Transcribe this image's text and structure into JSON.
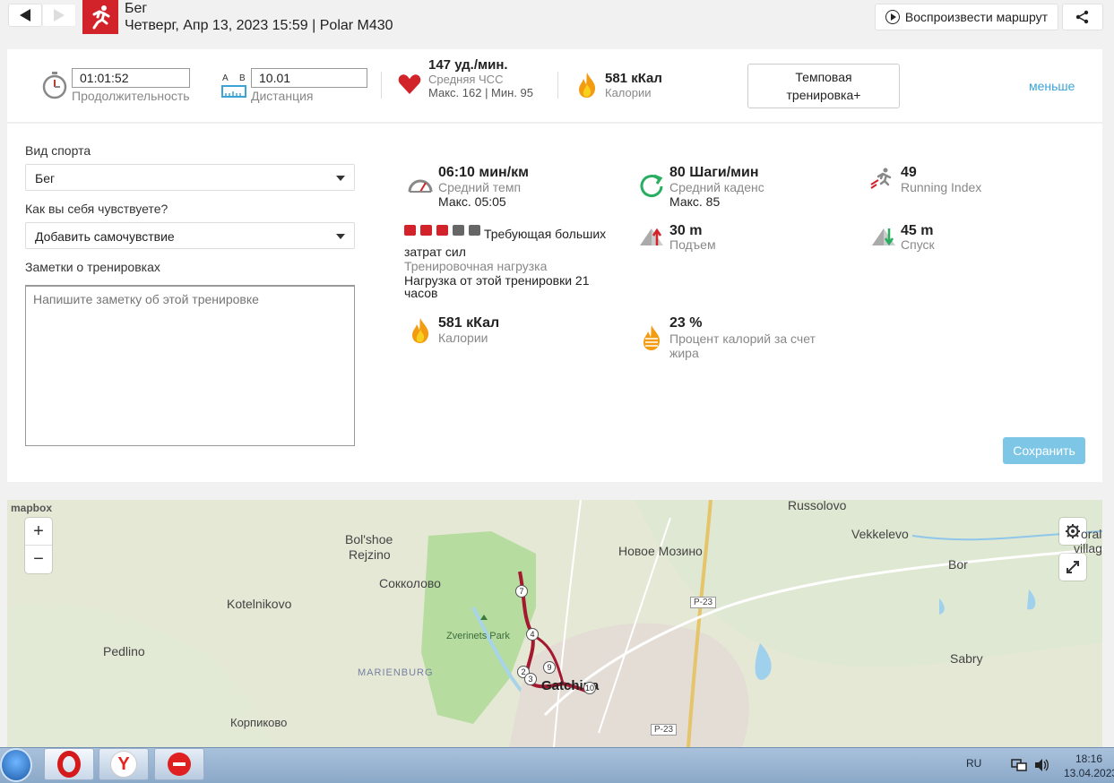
{
  "header": {
    "sport_name": "Бег",
    "subtitle": "Четверг, Апр 13, 2023 15:59 | Polar M430",
    "replay_label": "Воспроизвести маршрут",
    "back_icon": "triangle-left",
    "forward_icon": "triangle-right",
    "share_icon": "share-icon"
  },
  "summary": {
    "duration_value": "01:01:52",
    "duration_label": "Продолжительность",
    "distance_ab_a": "A",
    "distance_ab_b": "B",
    "distance_value": "10.01",
    "distance_label": "Дистанция",
    "hr_value": "147 уд./мин.",
    "hr_label": "Средняя ЧСС",
    "hr_minmax": "Макс. 162  |  Мин. 95",
    "cal_value": "581 кКал",
    "cal_label": "Калории",
    "training_type": "Темповая тренировка+",
    "less_link": "меньше"
  },
  "form": {
    "sport_label": "Вид спорта",
    "sport_value": "Бег",
    "feeling_label": "Как вы себя чувствуете?",
    "feeling_value": "Добавить самочувствие",
    "notes_label": "Заметки о тренировках",
    "notes_placeholder": "Напишите заметку об этой тренировке",
    "save_label": "Сохранить"
  },
  "stats": {
    "pace_value": "06:10 мин/км",
    "pace_label": "Средний темп",
    "pace_max": "Макс. 05:05",
    "cadence_value": "80 Шаги/мин",
    "cadence_label": "Средний каденс",
    "cadence_max": "Макс. 85",
    "ri_value": "49",
    "ri_label": "Running Index",
    "load_text": "Требующая больших затрат сил",
    "load_label": "Тренировочная нагрузка",
    "load_recovery": "Нагрузка от этой тренировки 21 часов",
    "load_level": 3,
    "load_max": 5,
    "ascent_value": "30 m",
    "ascent_label": "Подъем",
    "descent_value": "45 m",
    "descent_label": "Спуск",
    "cal_value": "581 кКал",
    "cal_label": "Калории",
    "fat_value": "23 %",
    "fat_label": "Процент калорий за счет жира"
  },
  "map": {
    "attribution": "mapbox",
    "zoom_in": "+",
    "zoom_out": "−",
    "places": {
      "russolovo": "Russolovo",
      "vekkelevo": "Vekkelevo",
      "oral": "oral",
      "villag": "villag",
      "bolshoe": "Bol'shoe",
      "rejzino": "Rejzino",
      "novoe": "Новое Мозино",
      "bor": "Bor",
      "sokkolovo": "Сокколово",
      "kotelnikovo": "Kotelnikovo",
      "p23a": "P-23",
      "zverinets": "Zverinets Park",
      "pedlino": "Pedlino",
      "sabry": "Sabry",
      "marienburg": "MARIENBURG",
      "gatchina": "Gatchina",
      "korpikovo": "Корпиково",
      "p23b": "P-23"
    },
    "km_markers": [
      "7",
      "4",
      "2",
      "3",
      "9",
      "10"
    ]
  },
  "taskbar": {
    "lang": "RU",
    "time": "18:16",
    "date": "13.04.2023"
  },
  "colors": {
    "brand_red": "#d2232a",
    "link_blue": "#3ba3d6",
    "save_bg": "#7ec6e6",
    "route": "#a41830"
  }
}
